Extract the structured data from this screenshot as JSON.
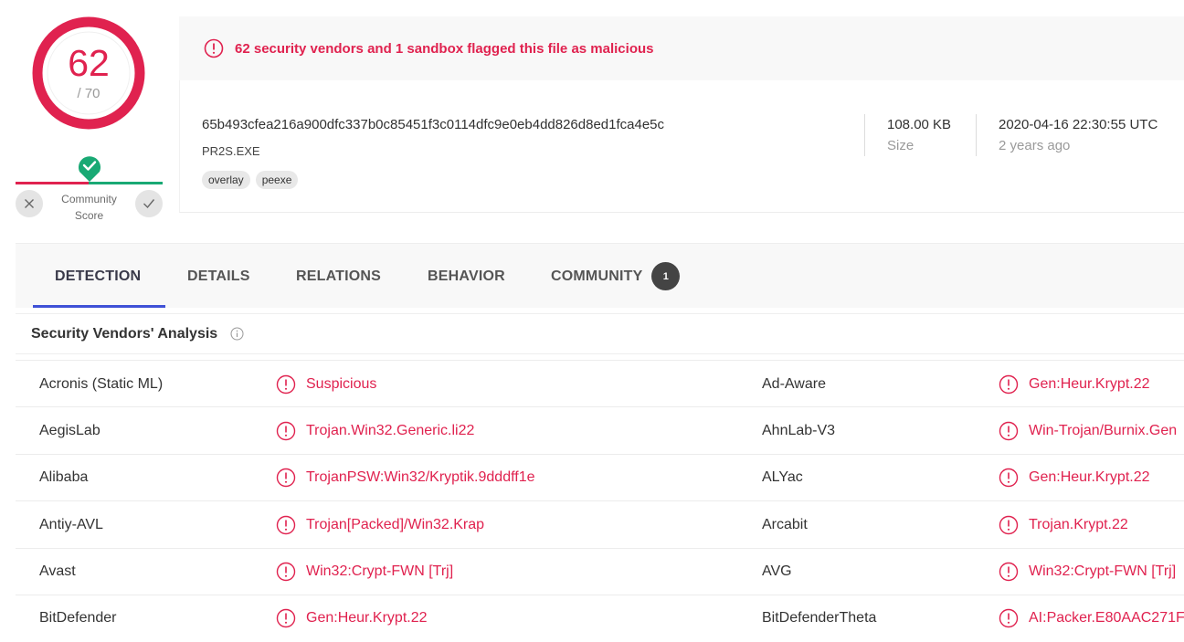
{
  "score": {
    "detections": "62",
    "total": "/ 70"
  },
  "community": {
    "label_line1": "Community",
    "label_line2": "Score"
  },
  "alert": {
    "text": "62 security vendors and 1 sandbox flagged this file as malicious"
  },
  "file": {
    "hash": "65b493cfea216a900dfc337b0c85451f3c0114dfc9e0eb4dd826d8ed1fca4e5c",
    "name": "PR2S.EXE",
    "tags": [
      "overlay",
      "peexe"
    ],
    "size_value": "108.00 KB",
    "size_label": "Size",
    "date_value": "2020-04-16 22:30:55 UTC",
    "date_relative": "2 years ago"
  },
  "tabs": [
    {
      "label": "DETECTION"
    },
    {
      "label": "DETAILS"
    },
    {
      "label": "RELATIONS"
    },
    {
      "label": "BEHAVIOR"
    },
    {
      "label": "COMMUNITY",
      "badge": "1"
    }
  ],
  "section": {
    "title": "Security Vendors' Analysis"
  },
  "vendors": [
    {
      "left_name": "Acronis (Static ML)",
      "left_result": "Suspicious",
      "right_name": "Ad-Aware",
      "right_result": "Gen:Heur.Krypt.22"
    },
    {
      "left_name": "AegisLab",
      "left_result": "Trojan.Win32.Generic.li22",
      "right_name": "AhnLab-V3",
      "right_result": "Win-Trojan/Burnix.Gen"
    },
    {
      "left_name": "Alibaba",
      "left_result": "TrojanPSW:Win32/Kryptik.9dddff1e",
      "right_name": "ALYac",
      "right_result": "Gen:Heur.Krypt.22"
    },
    {
      "left_name": "Antiy-AVL",
      "left_result": "Trojan[Packed]/Win32.Krap",
      "right_name": "Arcabit",
      "right_result": "Trojan.Krypt.22"
    },
    {
      "left_name": "Avast",
      "left_result": "Win32:Crypt-FWN [Trj]",
      "right_name": "AVG",
      "right_result": "Win32:Crypt-FWN [Trj]"
    },
    {
      "left_name": "BitDefender",
      "left_result": "Gen:Heur.Krypt.22",
      "right_name": "BitDefenderTheta",
      "right_result": "AI:Packer.E80AAC271F"
    }
  ],
  "colors": {
    "malicious": "#e0224f",
    "positive": "#19a974",
    "accent": "#3f51d6"
  },
  "icons": {
    "alert": "exclamation-circle-icon",
    "vote_down": "close-icon",
    "vote_up": "check-icon",
    "community_marker": "shield-check-icon",
    "info": "info-icon"
  }
}
